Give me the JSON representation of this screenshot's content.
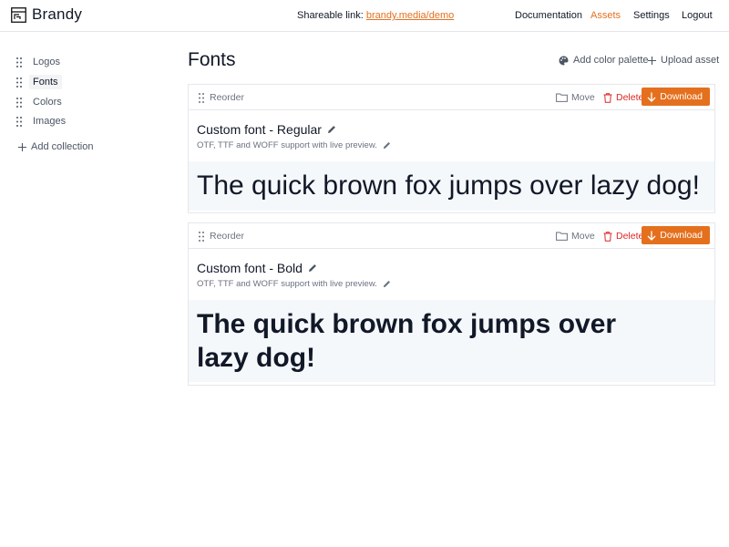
{
  "app": {
    "name": "Brandy"
  },
  "share": {
    "label": "Shareable link:",
    "link": "brandy.media/demo"
  },
  "nav": {
    "documentation": "Documentation",
    "assets": "Assets",
    "settings": "Settings",
    "logout": "Logout"
  },
  "sidebar": {
    "items": [
      {
        "label": "Logos"
      },
      {
        "label": "Fonts"
      },
      {
        "label": "Colors"
      },
      {
        "label": "Images"
      }
    ],
    "add_collection": "Add collection"
  },
  "page": {
    "title": "Fonts",
    "add_palette": "Add color palette",
    "upload": "Upload asset"
  },
  "cards": [
    {
      "reorder": "Reorder",
      "move": "Move",
      "delete": "Delete",
      "download": "Download",
      "name": "Custom font - Regular",
      "description": "OTF, TTF and WOFF support with live preview.",
      "preview": "The quick brown fox jumps over lazy dog!"
    },
    {
      "reorder": "Reorder",
      "move": "Move",
      "delete": "Delete",
      "download": "Download",
      "name": "Custom font - Bold",
      "description": "OTF, TTF and WOFF support with live preview.",
      "preview": "The quick brown fox jumps over lazy dog!"
    }
  ],
  "colors": {
    "accent": "#e4701e",
    "danger": "#dc2626",
    "preview_bg": "#f5f8fb"
  }
}
